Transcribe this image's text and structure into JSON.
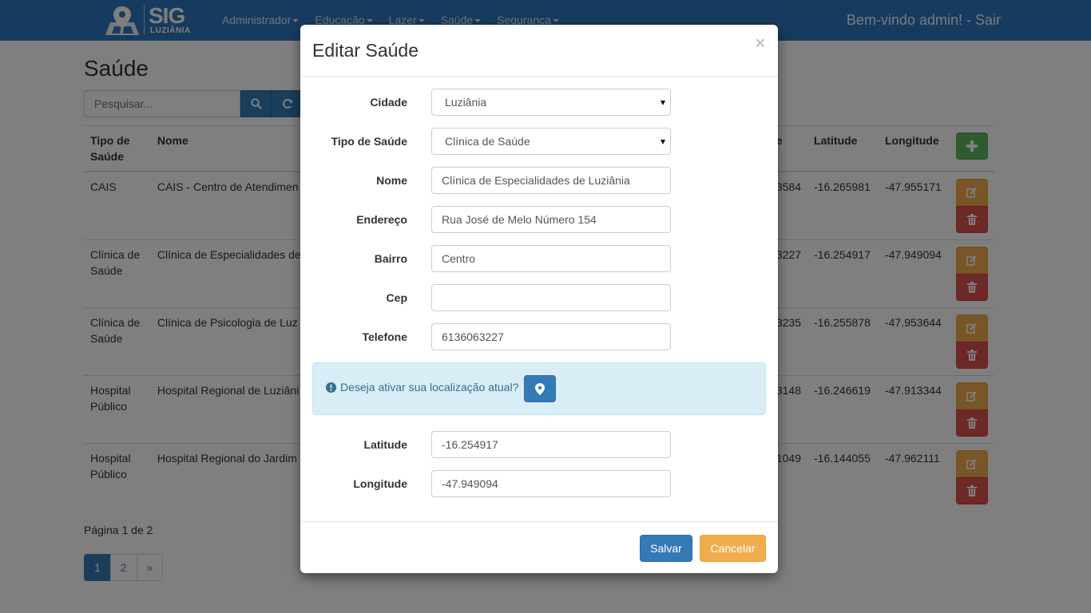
{
  "navbar": {
    "logo_text": "SIG",
    "logo_subtext": "LUZIÂNIA",
    "menu": [
      {
        "label": "Administrador"
      },
      {
        "label": "Educação"
      },
      {
        "label": "Lazer"
      },
      {
        "label": "Saúde"
      },
      {
        "label": "Segurança"
      }
    ],
    "welcome": "Bem-vindo admin! - Sair"
  },
  "page": {
    "title": "Saúde",
    "search_placeholder": "Pesquisar...",
    "columns": {
      "tipo": "Tipo de Saúde",
      "nome": "Nome",
      "telefone_tail": "e",
      "latitude": "Latitude",
      "longitude": "Longitude"
    },
    "rows": [
      {
        "tipo": "CAIS",
        "nome": "CAIS - Centro de Atendimen Doutor Wilson Cavalcante C",
        "tel_tail": "3584",
        "lat": "-16.265981",
        "lon": "-47.955171"
      },
      {
        "tipo": "Clínica de Saúde",
        "nome": "Clínica de Especialidades de",
        "tel_tail": "3227",
        "lat": "-16.254917",
        "lon": "-47.949094"
      },
      {
        "tipo": "Clínica de Saúde",
        "nome": "Clínica de Psicologia de Luz",
        "tel_tail": "3235",
        "lat": "-16.255878",
        "lon": "-47.953644"
      },
      {
        "tipo": "Hospital Público",
        "nome": "Hospital Regional de Luziâni Oliveira Almeida",
        "tel_tail": "3148",
        "lat": "-16.246619",
        "lon": "-47.913344"
      },
      {
        "tipo": "Hospital Público",
        "nome": "Hospital Regional do Jardim Joaquim de Melo",
        "tel_tail": "1049",
        "lat": "-16.144055",
        "lon": "-47.962111"
      }
    ],
    "page_info": "Página 1 de 2",
    "pagination": [
      "1",
      "2",
      "»"
    ]
  },
  "modal": {
    "title": "Editar Saúde",
    "close": "×",
    "fields": {
      "cidade": {
        "label": "Cidade",
        "value": "Luziânia"
      },
      "tipo": {
        "label": "Tipo de Saúde",
        "value": "Clínica de Saúde"
      },
      "nome": {
        "label": "Nome",
        "value": "Clínica de Especialidades de Luziânia"
      },
      "endereco": {
        "label": "Endereço",
        "value": "Rua José de Melo Número 154"
      },
      "bairro": {
        "label": "Bairro",
        "value": "Centro"
      },
      "cep": {
        "label": "Cep",
        "value": ""
      },
      "telefone": {
        "label": "Telefone",
        "value": "6136063227"
      },
      "latitude": {
        "label": "Latitude",
        "value": "-16.254917"
      },
      "longitude": {
        "label": "Longitude",
        "value": "-47.949094"
      }
    },
    "alert_text": "Deseja ativar sua localização atual?",
    "save": "Salvar",
    "cancel": "Cancelar"
  },
  "colors": {
    "navbar": "#2f77bf",
    "primary": "#337ab7",
    "success": "#5cb85c",
    "warning": "#f0ad4e",
    "danger": "#d9534f",
    "info_bg": "#d9edf7"
  },
  "icons": [
    "map-pin-logo-icon",
    "search-icon",
    "refresh-icon",
    "plus-icon",
    "edit-icon",
    "trash-icon",
    "exclamation-circle-icon",
    "map-marker-icon"
  ]
}
